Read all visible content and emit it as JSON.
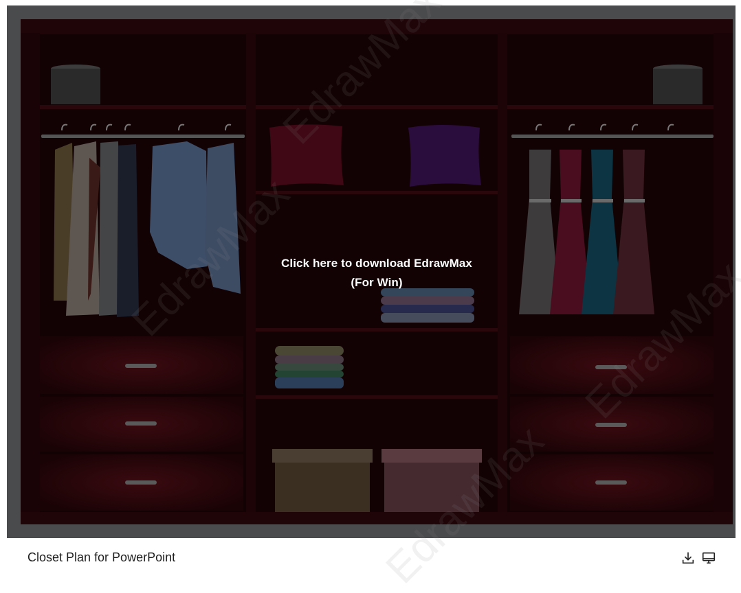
{
  "preview": {
    "overlay_line1": "Click here to download EdrawMax",
    "overlay_line2": "(For Win)"
  },
  "card": {
    "title": "Closet Plan for PowerPoint",
    "download_icon": "download-icon",
    "desktop_icon": "desktop-icon"
  },
  "watermark": {
    "text": "EdrawMax"
  },
  "colors": {
    "frame": "#4a4b4d",
    "closet_dark": "#130204",
    "overlay_text": "#ffffff"
  }
}
